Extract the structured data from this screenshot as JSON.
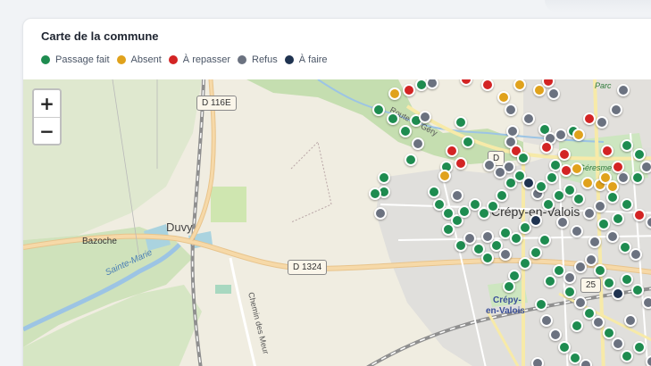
{
  "card": {
    "title": "Carte de la commune"
  },
  "legend": [
    {
      "label": "Passage fait",
      "color": "#1e8c50"
    },
    {
      "label": "Absent",
      "color": "#e0a21c"
    },
    {
      "label": "À repasser",
      "color": "#d32424"
    },
    {
      "label": "Refus",
      "color": "#6b7280"
    },
    {
      "label": "À faire",
      "color": "#1f3350"
    }
  ],
  "map": {
    "zoom_in": "+",
    "zoom_out": "−",
    "labels": {
      "duvy": "Duvy",
      "bazoche": "Bazoche",
      "sainte_marie": "Sainte-Marie",
      "crepy": "Crépy-en-Valois",
      "crepy_station_1": "Crépy-",
      "crepy_station_2": "en-Valois",
      "route_gery": "Route de Géry",
      "chemin": "Chemin des Meur",
      "parc": "Parc",
      "geresme": "Géresme",
      "d116e": "D 116E",
      "d1324": "D 1324",
      "d_short": "D",
      "d25": "25"
    }
  }
}
